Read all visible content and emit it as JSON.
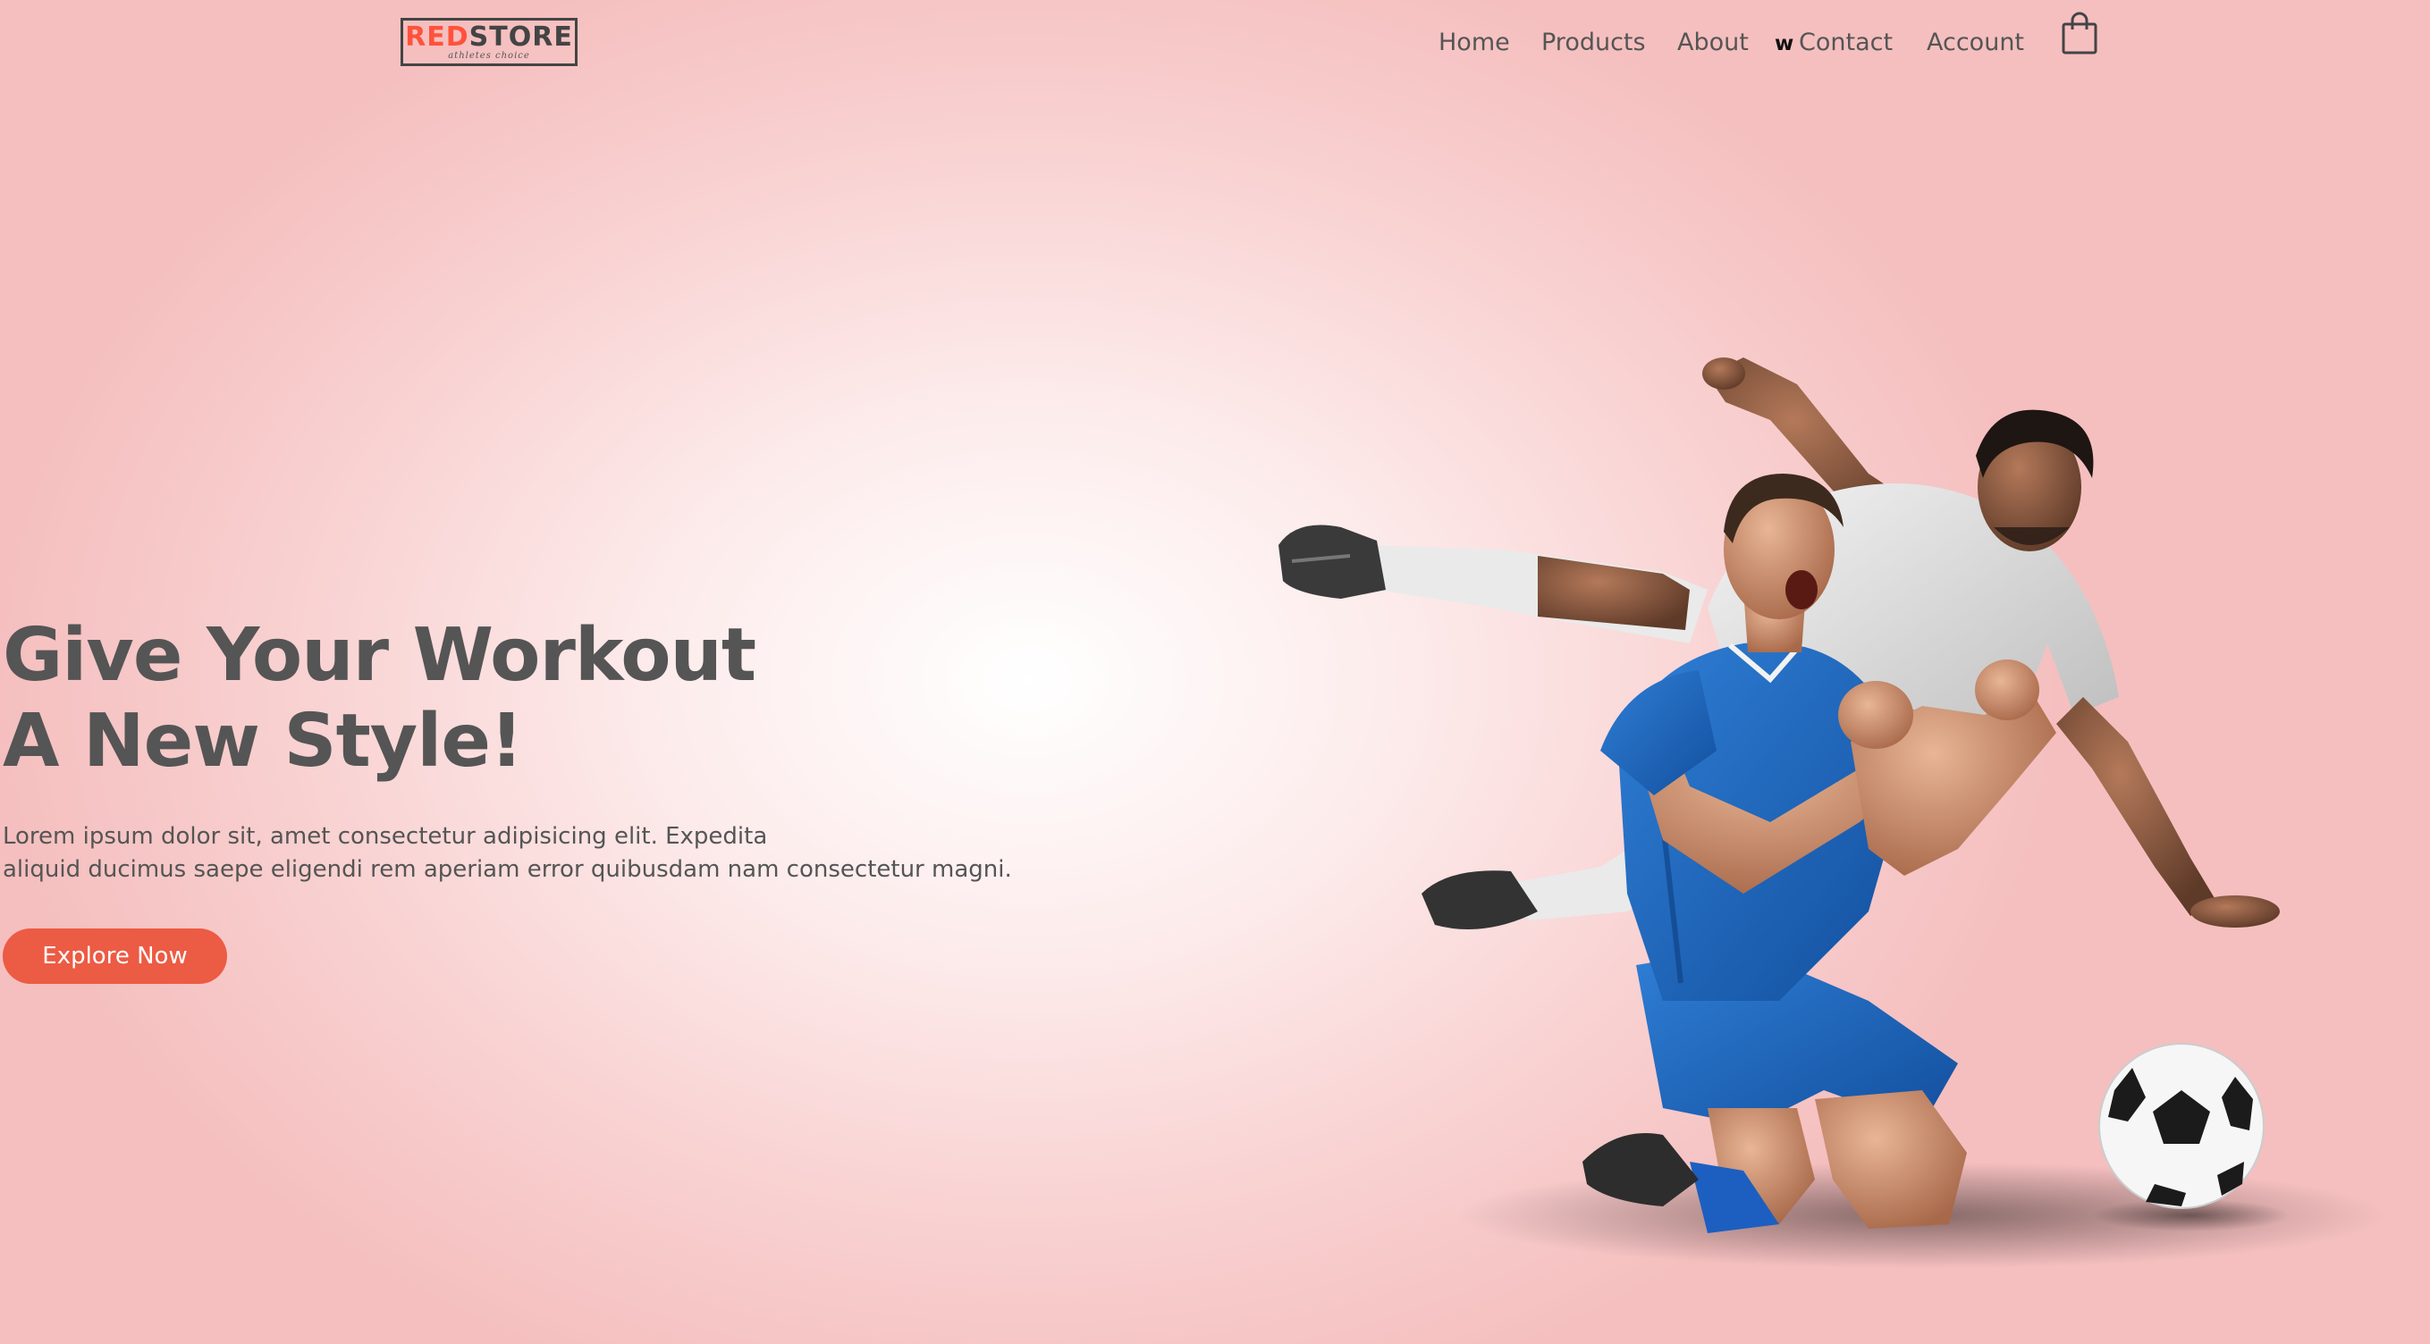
{
  "brand": {
    "logo_red": "RED",
    "logo_dark": "STORE",
    "tagline": "athletes choice"
  },
  "nav": {
    "items": [
      {
        "label": "Home"
      },
      {
        "label": "Products"
      },
      {
        "label": "About"
      },
      {
        "label": "Contact"
      },
      {
        "label": "Account"
      }
    ],
    "stray_glyph": "w",
    "cart_icon": "shopping-bag-icon"
  },
  "hero": {
    "headline_line1": "Give Your Workout",
    "headline_line2": "A New Style!",
    "paragraph_line1": "Lorem ipsum dolor sit, amet consectetur adipisicing elit. Expedita",
    "paragraph_line2": "aliquid ducimus saepe eligendi rem aperiam error quibusdam nam consectetur magni.",
    "button_label": "Explore Now",
    "image": "football-players-celebrating"
  },
  "colors": {
    "accent": "#ff523b",
    "button": "#ec5b44",
    "text": "#555555",
    "background": "#f9d2d2"
  }
}
